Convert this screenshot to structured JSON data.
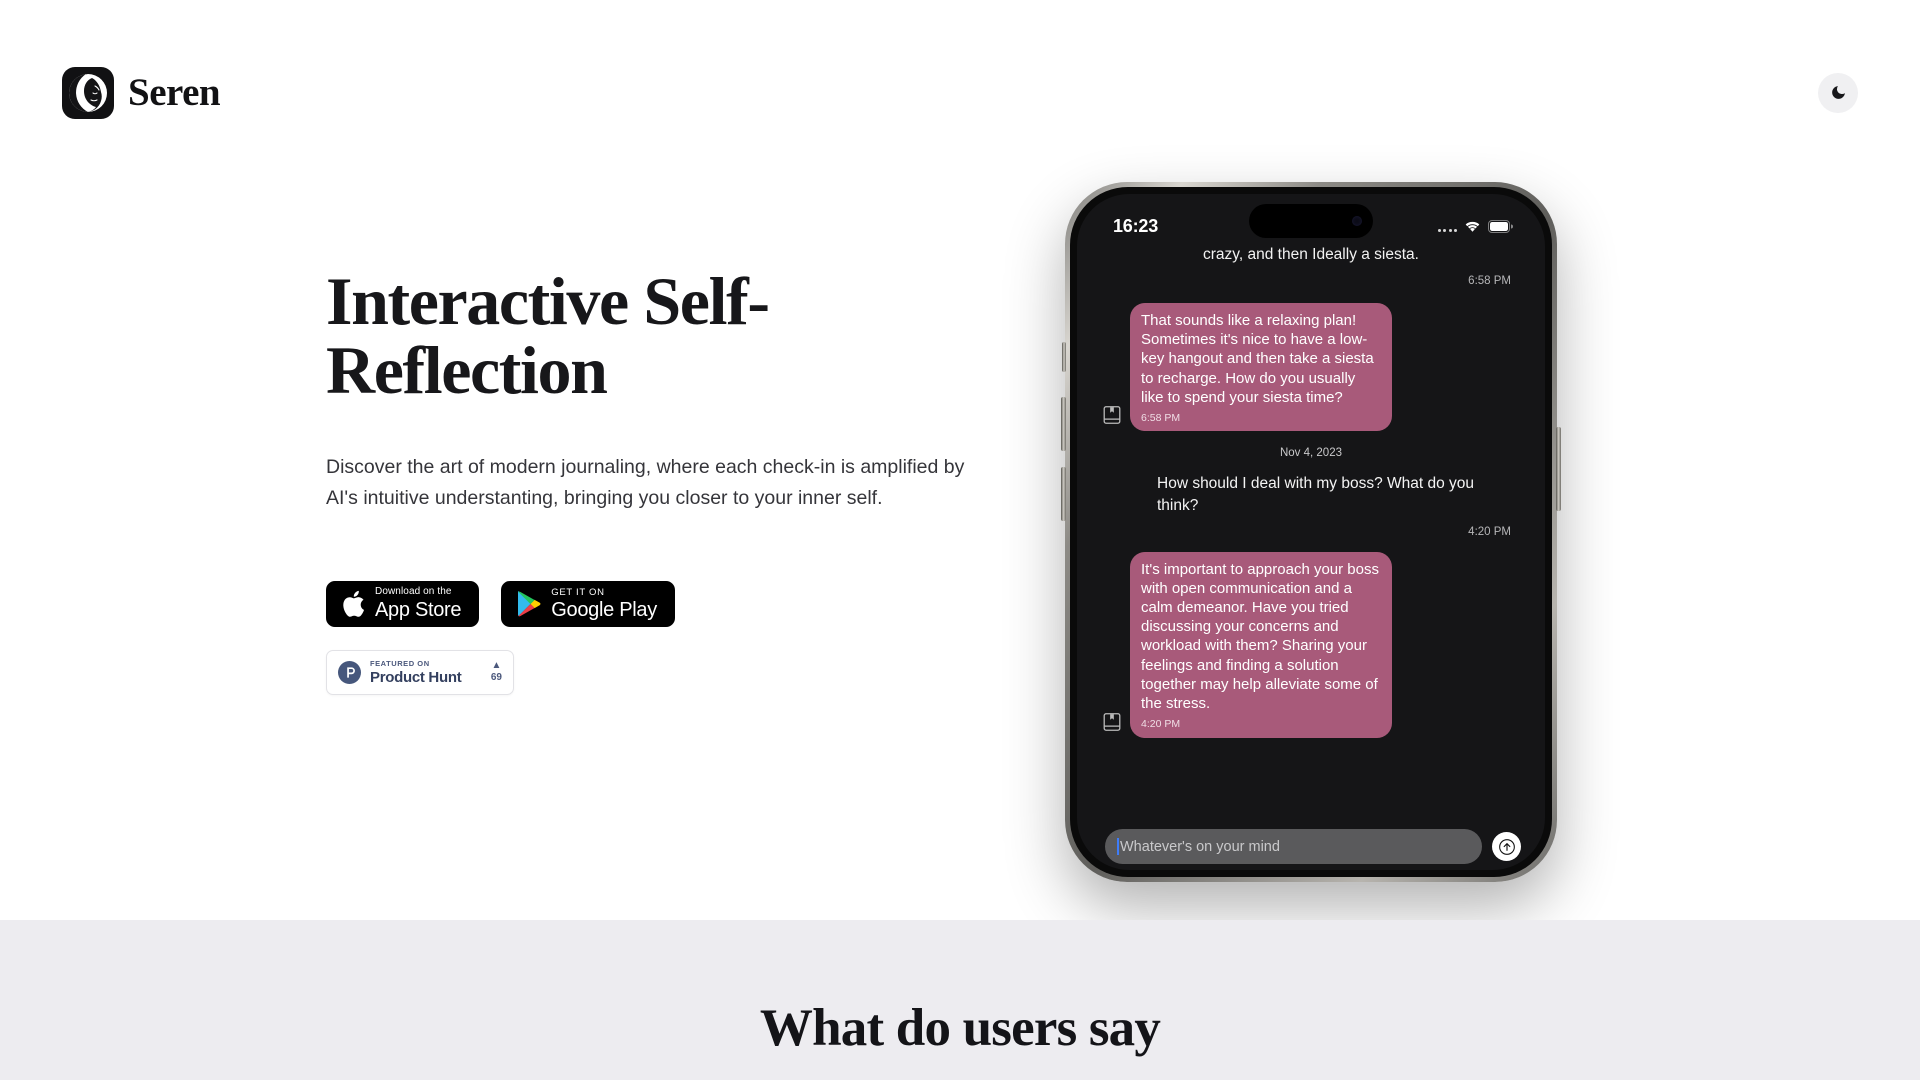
{
  "header": {
    "brand_name": "Seren",
    "logo_icon": "moon-face-logo",
    "theme_toggle_icon": "moon-icon"
  },
  "hero": {
    "title": "Interactive Self-Reflection",
    "subtitle": "Discover the art of modern journaling, where each check-in is amplified by AI's intuitive understanting, bringing you closer to your inner self.",
    "app_store": {
      "small": "Download on the",
      "big": "App Store",
      "icon": "apple-logo-icon"
    },
    "google_play": {
      "small": "GET IT ON",
      "big": "Google Play",
      "icon": "google-play-icon"
    },
    "product_hunt": {
      "featured": "FEATURED ON",
      "name": "Product Hunt",
      "arrow": "▲",
      "count": "69",
      "icon": "product-hunt-icon"
    }
  },
  "phone": {
    "status": {
      "time": "16:23",
      "signal_icon": "cellular-dots-icon",
      "wifi_icon": "wifi-icon",
      "battery_icon": "battery-icon"
    },
    "chat": {
      "partial_message": "crazy, and then Ideally a siesta.",
      "partial_time": "6:58 PM",
      "messages": [
        {
          "role": "assistant",
          "text": "That sounds like a relaxing plan! Sometimes it's nice to have a low-key hangout and then take a siesta to recharge. How do you usually like to spend your siesta time?",
          "time": "6:58 PM",
          "bookmark_icon": "journal-bookmark-icon"
        },
        {
          "role": "user",
          "text": "How should I deal with my boss? What do you think?",
          "time": "4:20 PM"
        },
        {
          "role": "assistant",
          "text": "It's important to approach your boss with open communication and a calm demeanor. Have you tried discussing your concerns and workload with them? Sharing your feelings and finding a solution together may help alleviate some of the stress.",
          "time": "4:20 PM",
          "bookmark_icon": "journal-bookmark-icon"
        }
      ],
      "date_separator": "Nov 4, 2023"
    },
    "composer": {
      "placeholder": "Whatever's on your mind",
      "send_icon": "arrow-up-icon"
    }
  },
  "testimonials": {
    "title": "What do users say"
  },
  "colors": {
    "bubble": "#a85a7a",
    "page_bg": "#ffffff",
    "section_bg": "#edecf0",
    "text": "#17171a",
    "product_hunt": "#34405f",
    "caret": "#3e7dfa"
  }
}
